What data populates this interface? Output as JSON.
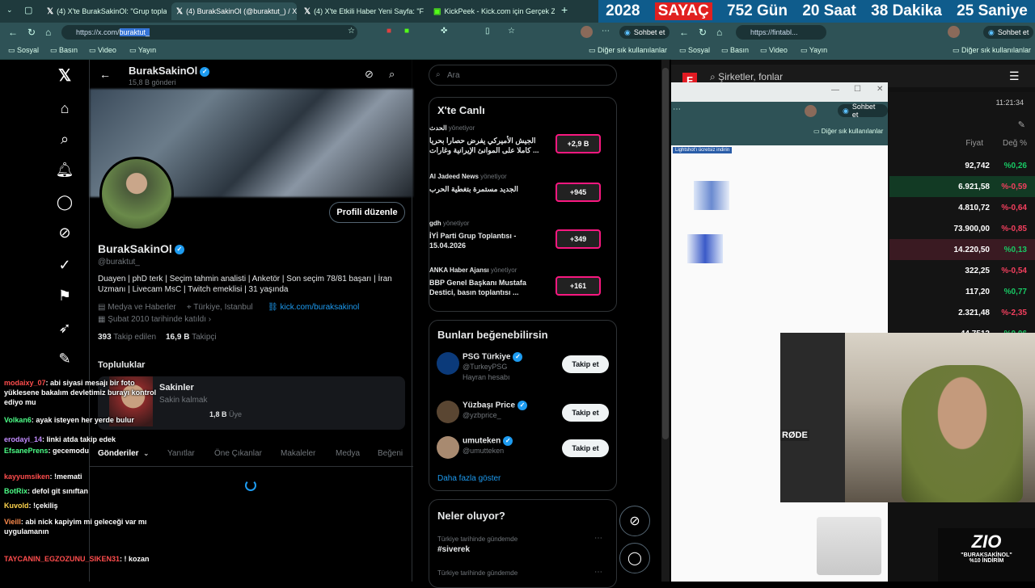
{
  "tabs": [
    {
      "label": "(4) X'te BurakSakinOl: \"Grup topla",
      "active": false
    },
    {
      "label": "(4) BurakSakinOl (@buraktut_) / X",
      "active": true
    },
    {
      "label": "(4) X'te Etkili Haber Yeni Sayfa: \"Fa",
      "active": false
    },
    {
      "label": "KickPeek - Kick.com için Gerçek Za",
      "active": false
    }
  ],
  "counter": {
    "year": "2028",
    "label": "SAYAÇ",
    "days": "752 Gün",
    "hours": "20 Saat",
    "minutes": "38 Dakika",
    "seconds": "25 Saniye"
  },
  "address": {
    "prefix": "https://x.com/",
    "selected": "buraktut_",
    "right_url": "https://fintabl..."
  },
  "chat_button": "Sohbet et",
  "bookmarks": [
    "Sosyal",
    "Basın",
    "Video",
    "Yayın"
  ],
  "bookmarks_other": "Diğer sık kullanılanlar",
  "profile": {
    "header_name": "BurakSakinOl",
    "header_posts": "15,8 B gönderi",
    "edit_button": "Profili düzenle",
    "name": "BurakSakinOl",
    "handle": "@buraktut_",
    "bio": "Duayen | phD terk | Seçim tahmin analisti | Anketör | Son seçim 78/81 başarı | İran Uzmanı | Livecam MsC | Twitch emeklisi | 31 yaşında",
    "category": "Medya ve Haberler",
    "location": "Türkiye, Istanbul",
    "link": "kick.com/buraksakinol",
    "joined": "Şubat 2010 tarihinde katıldı",
    "following_count": "393",
    "following_label": "Takip edilen",
    "followers_count": "16,9 B",
    "followers_label": "Takipçi",
    "communities_title": "Topluluklar",
    "community_name": "Sakinler",
    "community_desc": "Sakin kalmak",
    "community_members": "1,8 B",
    "community_members_label": "Üye",
    "tabs": [
      "Gönderiler",
      "Yanıtlar",
      "Öne Çıkanlar",
      "Makaleler",
      "Medya",
      "Beğeni"
    ]
  },
  "chat": [
    {
      "user": "modaixy_07",
      "msg": " abi siyasi mesajı bir foto yüklesene bakalım devletimiz burayı kontrol ediyo mu",
      "color": "#ff4d4d"
    },
    {
      "user": "Volkan6",
      "msg": " ayak isteyen her yerde bulur",
      "color": "#4dff88"
    },
    {
      "user": "erodayi_14",
      "msg": " linki atda takip edek",
      "color": "#c38cff"
    },
    {
      "user": "EfsanePrens",
      "msg": " gecemodu",
      "color": "#4dff88"
    },
    {
      "user": "kayyumsiken",
      "msg": " !memati",
      "color": "#ff4d4d"
    },
    {
      "user": "BotRix",
      "msg": " defol git sınıftan",
      "color": "#4dff88"
    },
    {
      "user": "Kuvold",
      "msg": " !çekiliş",
      "color": "#ffd54d"
    },
    {
      "user": "Vieill",
      "msg": " abi nick kapiyim mi geleceği var mı uygulamanın",
      "color": "#ff8c4d"
    },
    {
      "user": "TAYCANIN_EGZOZUNU_SIKEN31",
      "msg": " ! kozan",
      "color": "#ff4d4d"
    }
  ],
  "right": {
    "search_placeholder": "Ara",
    "live_title": "X'te Canlı",
    "live": [
      {
        "host": "الحدث",
        "role": "yönetiyor",
        "title": "الجيش الأميركي يفرض حصارا بحريا كاملا على الموانئ الإيرانية وغارات ...",
        "count": "+2,9 B"
      },
      {
        "host": "Al Jadeed News",
        "role": "yönetiyor",
        "title": "الجديد مستمرة بتغطية الحرب",
        "count": "+945"
      },
      {
        "host": "gdh",
        "role": "yönetiyor",
        "title": "İYİ Parti Grup Toplantısı - 15.04.2026",
        "count": "+349"
      },
      {
        "host": "ANKA Haber Ajansı",
        "role": "yönetiyor",
        "title": "BBP Genel Başkanı Mustafa Destici, basın toplantısı ...",
        "count": "+161"
      }
    ],
    "suggest_title": "Bunları beğenebilirsin",
    "suggest": [
      {
        "name": "PSG Türkiye",
        "handle": "@TurkeyPSG",
        "extra": "Hayran hesabı",
        "color": "#0b3a7a"
      },
      {
        "name": "Yüzbaşı Price",
        "handle": "@yzbprice_",
        "extra": "",
        "color": "#5a4632"
      },
      {
        "name": "umuteken",
        "handle": "@umutteken",
        "extra": "",
        "color": "#a88a70"
      }
    ],
    "follow_label": "Takip et",
    "show_more": "Daha fazla göster",
    "trends_title": "Neler oluyor?",
    "trend_context": "Türkiye tarihinde gündemde",
    "trend_tag": "#siverek",
    "trend_context2": "Türkiye tarihinde gündemde"
  },
  "fintables": {
    "search_placeholder": "Şirketler, fonlar",
    "time": "11:21:34",
    "col_price": "Fiyat",
    "col_change": "Değ %",
    "rows": [
      {
        "price": "92,742",
        "change": "%0,26",
        "dir": "up"
      },
      {
        "price": "6.921,58",
        "change": "%-0,59",
        "dir": "dn"
      },
      {
        "price": "4.810,72",
        "change": "%-0,64",
        "dir": "dn"
      },
      {
        "price": "73.900,00",
        "change": "%-0,85",
        "dir": "dn"
      },
      {
        "price": "14.220,50",
        "change": "%0,13",
        "dir": "up"
      },
      {
        "price": "322,25",
        "change": "%-0,54",
        "dir": "dn"
      },
      {
        "price": "117,20",
        "change": "%0,77",
        "dir": "up"
      },
      {
        "price": "2.321,48",
        "change": "%-2,35",
        "dir": "dn"
      },
      {
        "price": "44.7512",
        "change": "%0,06",
        "dir": "up"
      }
    ],
    "popup_chat": "Sohbet et",
    "popup_bookmarks": "Diğer sık kullanılanlar",
    "popup_banner": "Lightshot'ı ücretsiz indirin"
  },
  "stream": {
    "brand": "ZIO",
    "promo_name": "\"BURAKSAKİNOL\"",
    "promo_discount": "%10 İNDİRİM",
    "mic": "RØDE"
  }
}
